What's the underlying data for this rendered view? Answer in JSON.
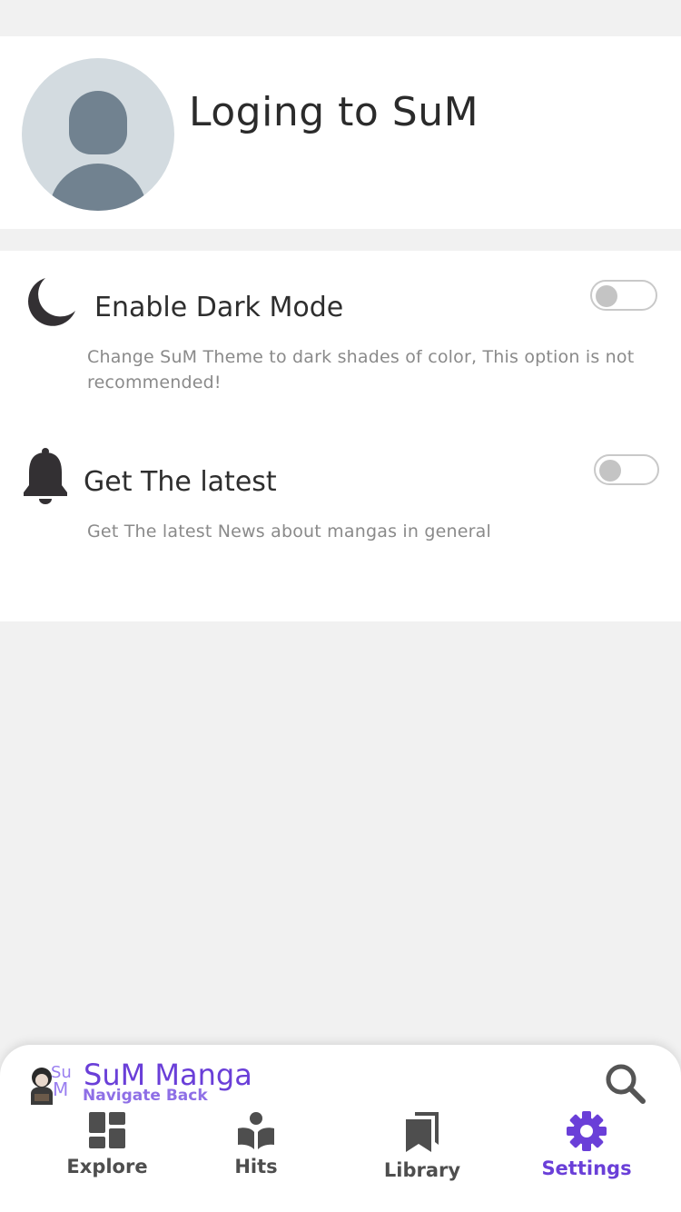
{
  "profile": {
    "login_text": "Loging to SuM",
    "avatar_icon": "default-user-avatar"
  },
  "settings": [
    {
      "icon": "moon-icon",
      "title": "Enable Dark Mode",
      "description": "Change SuM Theme to dark shades of color, This option is not recommended!",
      "enabled": false
    },
    {
      "icon": "bell-icon",
      "title": "Get The latest",
      "description": "Get The latest News about mangas in general",
      "enabled": false
    }
  ],
  "bottom_bar": {
    "brand_name": "SuM Manga",
    "brand_subtitle": "Navigate Back",
    "logo_text": "Su M",
    "search_icon": "search-icon",
    "nav": [
      {
        "label": "Explore",
        "icon": "dashboard-icon",
        "active": false
      },
      {
        "label": "Hits",
        "icon": "book-reader-icon",
        "active": false
      },
      {
        "label": "Library",
        "icon": "bookmarks-icon",
        "active": false
      },
      {
        "label": "Settings",
        "icon": "gear-icon",
        "active": true
      }
    ]
  },
  "colors": {
    "accent": "#6a3fd8",
    "background": "#f1f1f1",
    "card": "#ffffff",
    "avatar_bg": "#d3dbe0",
    "avatar_fg": "#718290",
    "text_muted": "#8a8a8a"
  }
}
